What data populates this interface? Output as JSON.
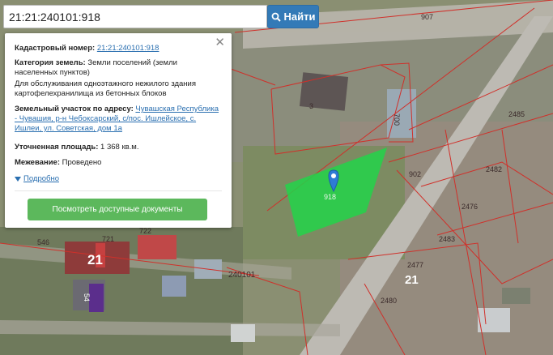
{
  "search": {
    "value": "21:21:240101:918",
    "button_label": "Найти"
  },
  "info_panel": {
    "cadastral_label": "Кадастровый номер:",
    "cadastral_value": "21:21:240101:918",
    "category_label": "Категория земель:",
    "category_value": "Земли поселений (земли населенных пунктов)",
    "purpose_text": "Для обслуживания одноэтажного нежилого здания картофелехранилища из бетонных блоков",
    "address_label": "Земельный участок по адресу:",
    "address_value": "Чувашская Республика - Чувашия, р-н Чебоксарский, с/пос. Ишлейское, с. Ишлеи, ул. Советская, дом 1а",
    "area_label": "Уточненная площадь:",
    "area_value": "1 368 кв.м.",
    "survey_label": "Межевание:",
    "survey_value": "Проведено",
    "more_label": "Подробно",
    "docs_button": "Посмотреть доступные документы",
    "close_symbol": "✕"
  },
  "map": {
    "parcel_label": "918",
    "labels": {
      "l907": "907",
      "l902": "902",
      "l3": "3",
      "l700": "700",
      "l2485": "2485",
      "l2482": "2482",
      "l2476": "2476",
      "l2483": "2483",
      "l2477": "2477",
      "l2480": "2480",
      "l21a": "21",
      "l21b": "21",
      "l721": "721",
      "l722": "722",
      "l546": "546",
      "l240101": "240101",
      "l54": "54"
    },
    "colors": {
      "parcel": "#22d44a",
      "boundary": "#d0302a",
      "marker": "#2e7bd6"
    }
  }
}
